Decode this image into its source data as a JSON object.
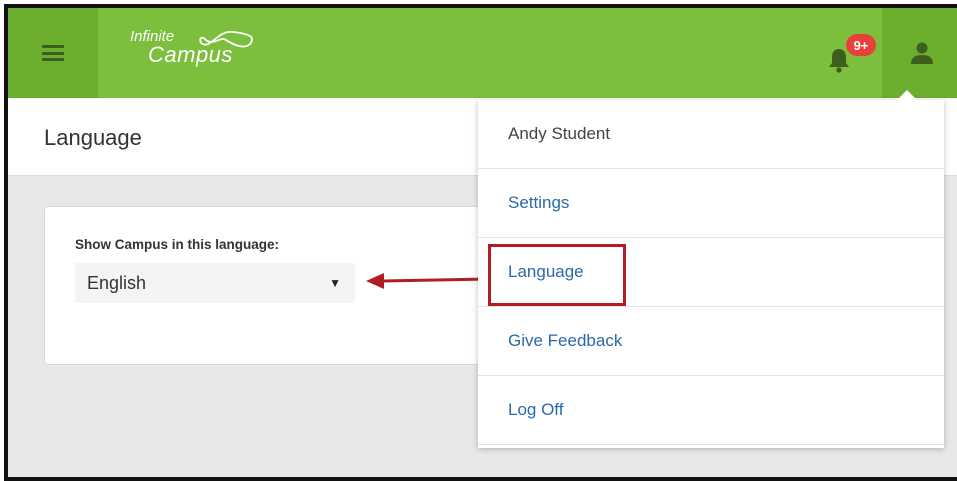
{
  "app": {
    "logo_line1": "Infinite",
    "logo_line2": "Campus",
    "notification_badge": "9+",
    "colors": {
      "brand_green": "#7cbf3c",
      "brand_green_dark": "#6cae2e",
      "badge_red": "#e8413c",
      "link_blue": "#2a6aa6",
      "highlight_red": "#b01e23"
    }
  },
  "page": {
    "title": "Language"
  },
  "language_card": {
    "label": "Show Campus in this language:",
    "selected": "English",
    "arrow_glyph": "▼"
  },
  "user_menu": {
    "items": [
      {
        "label": "Andy Student"
      },
      {
        "label": "Settings"
      },
      {
        "label": "Language"
      },
      {
        "label": "Give Feedback"
      },
      {
        "label": "Log Off"
      }
    ]
  },
  "icons": {
    "menu": "hamburger-icon",
    "bell": "bell-icon",
    "user": "user-icon",
    "dropdown": "chevron-down-icon",
    "annotation": "red-arrow-icon"
  }
}
